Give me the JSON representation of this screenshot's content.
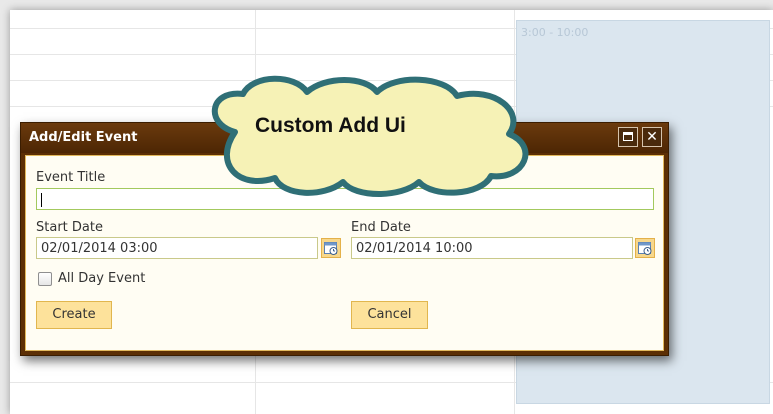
{
  "scheduler": {
    "appointment_time": "3:00 - 10:00"
  },
  "dialog": {
    "title": "Add/Edit Event",
    "fields": {
      "event_title_label": "Event Title",
      "event_title_value": "",
      "start_date_label": "Start Date",
      "start_date_value": "02/01/2014 03:00",
      "end_date_label": "End Date",
      "end_date_value": "02/01/2014 10:00",
      "all_day_label": "All Day Event",
      "all_day_checked": false
    },
    "buttons": {
      "create": "Create",
      "cancel": "Cancel"
    },
    "window_controls": [
      "maximize-icon",
      "close-icon"
    ]
  },
  "callout": {
    "text": "Custom Add Ui"
  },
  "colors": {
    "titlebar": "#5c2f05",
    "content_bg": "#fffdf3",
    "button_bg": "#fde29b",
    "appointment_bg": "#dbe6ef",
    "cloud_fill": "#f6f2b6",
    "cloud_stroke": "#2f6f76"
  }
}
